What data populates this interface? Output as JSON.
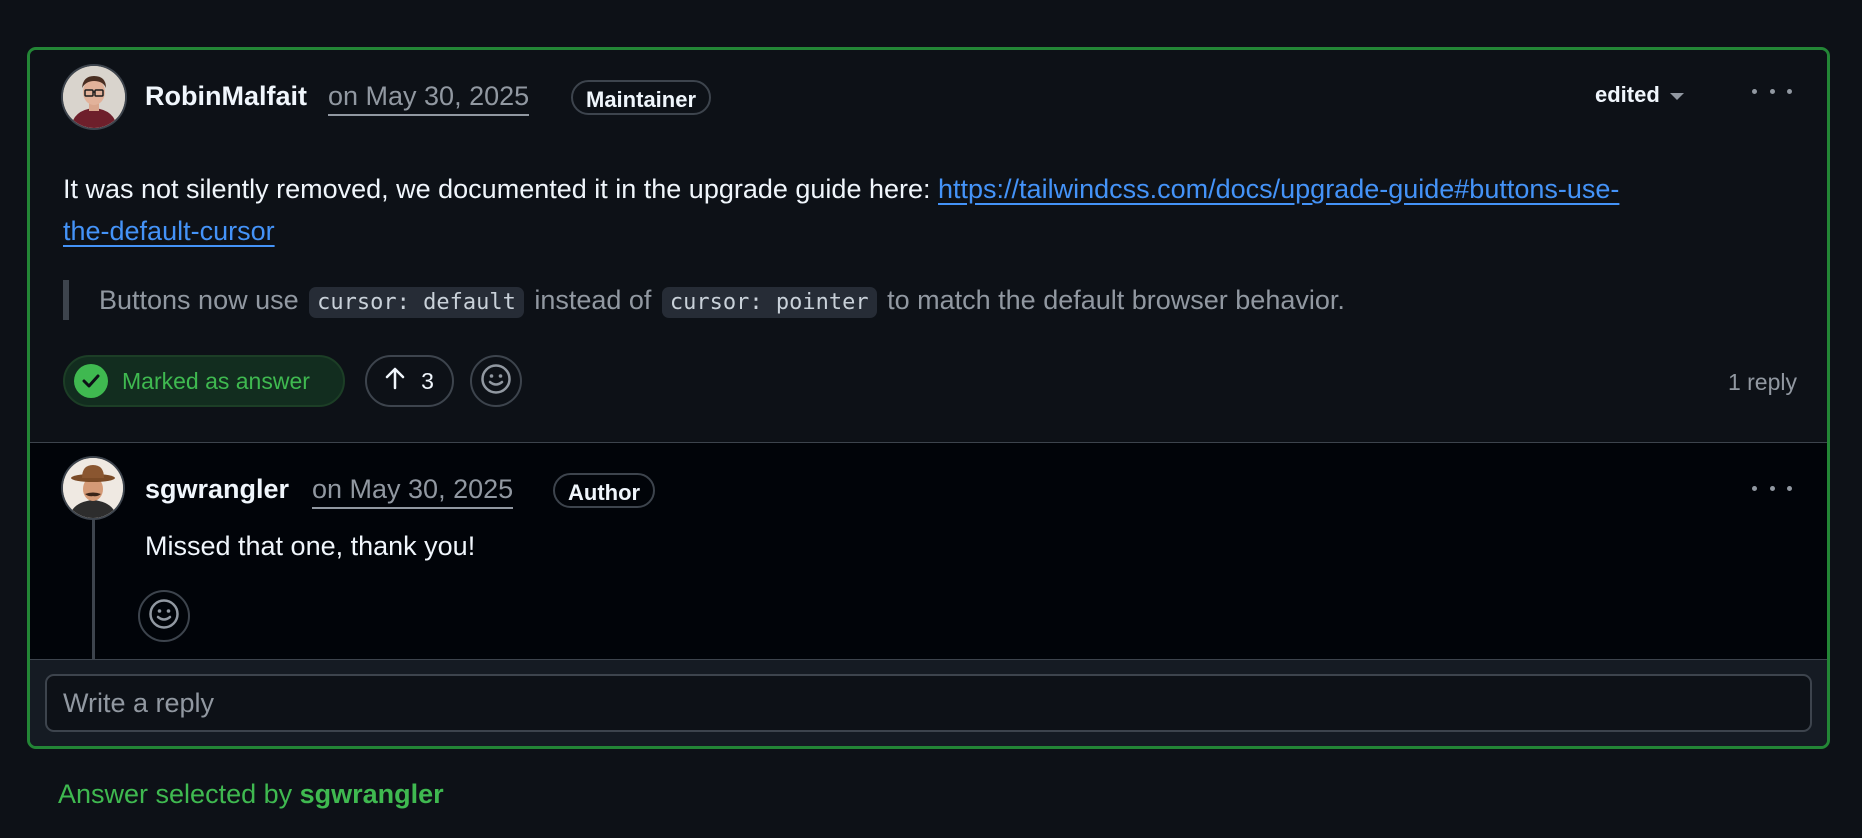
{
  "comment": {
    "author": "RobinMalfait",
    "date": "on May 30, 2025",
    "badge": "Maintainer",
    "edited_label": "edited",
    "body_prefix": "It was not silently removed, we documented it in the upgrade guide here: ",
    "link_line1": "https://tailwindcss.com/docs/upgrade-guide#buttons-use-",
    "link_line2": "the-default-cursor",
    "quote": {
      "part1": "Buttons now use ",
      "code1": "cursor: default",
      "part2": " instead of ",
      "code2": "cursor: pointer",
      "part3": " to match the default browser behavior."
    },
    "answer_label": "Marked as answer",
    "upvotes": "3",
    "reply_count": "1 reply"
  },
  "reply": {
    "author": "sgwrangler",
    "date": "on May 30, 2025",
    "badge": "Author",
    "text": "Missed that one, thank you!"
  },
  "reply_box": {
    "placeholder": "Write a reply"
  },
  "footer": {
    "prefix": "Answer selected by ",
    "user": "sgwrangler"
  },
  "colors": {
    "accent_green": "#3fb950",
    "link_blue": "#4493f8",
    "border_green": "#238636"
  }
}
